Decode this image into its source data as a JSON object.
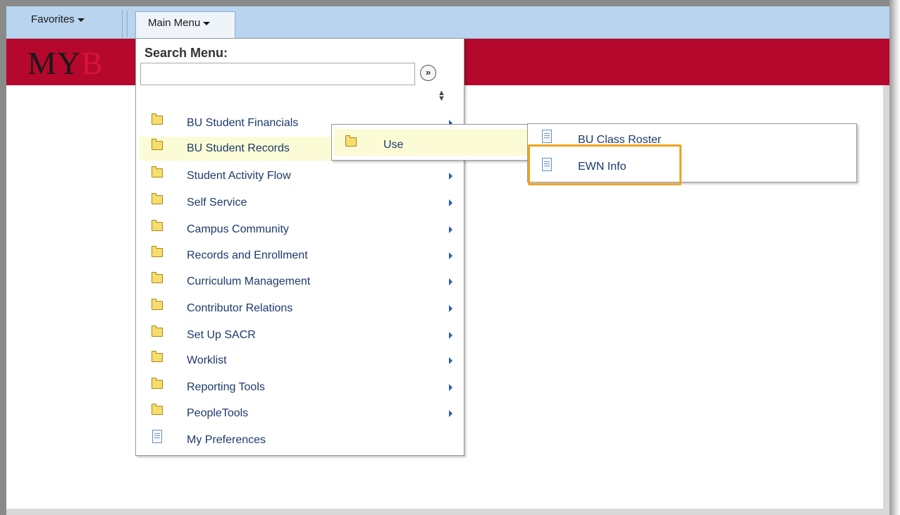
{
  "nav": {
    "favorites_label": "Favorites",
    "main_menu_label": "Main Menu"
  },
  "banner": {
    "logo_part1": "MY",
    "logo_part2": "B"
  },
  "menu": {
    "search_title": "Search Menu:",
    "search_value": "",
    "go_icon": "double-chevron-right-icon",
    "items": [
      {
        "label": "BU Student Financials",
        "icon": "folder",
        "has_submenu": true
      },
      {
        "label": "BU Student Records",
        "icon": "folder",
        "has_submenu": true,
        "active": true
      },
      {
        "label": "Student Activity Flow",
        "icon": "folder",
        "has_submenu": true
      },
      {
        "label": "Self Service",
        "icon": "folder",
        "has_submenu": true
      },
      {
        "label": "Campus Community",
        "icon": "folder",
        "has_submenu": true
      },
      {
        "label": "Records and Enrollment",
        "icon": "folder",
        "has_submenu": true
      },
      {
        "label": "Curriculum Management",
        "icon": "folder",
        "has_submenu": true
      },
      {
        "label": "Contributor Relations",
        "icon": "folder",
        "has_submenu": true
      },
      {
        "label": "Set Up SACR",
        "icon": "folder",
        "has_submenu": true
      },
      {
        "label": "Worklist",
        "icon": "folder",
        "has_submenu": true
      },
      {
        "label": "Reporting Tools",
        "icon": "folder",
        "has_submenu": true
      },
      {
        "label": "PeopleTools",
        "icon": "folder",
        "has_submenu": true
      },
      {
        "label": "My Preferences",
        "icon": "document",
        "has_submenu": false
      }
    ]
  },
  "submenu1": {
    "items": [
      {
        "label": "Use",
        "icon": "folder"
      }
    ]
  },
  "submenu2": {
    "items": [
      {
        "label": "BU Class Roster",
        "icon": "document"
      },
      {
        "label": "EWN Info",
        "icon": "document",
        "highlighted": true
      }
    ]
  },
  "colors": {
    "navbar": "#b8d4ee",
    "banner": "#b5082c",
    "active_row": "#fbfbd6",
    "highlight": "#f0a31e",
    "link": "#1c3a6e"
  }
}
